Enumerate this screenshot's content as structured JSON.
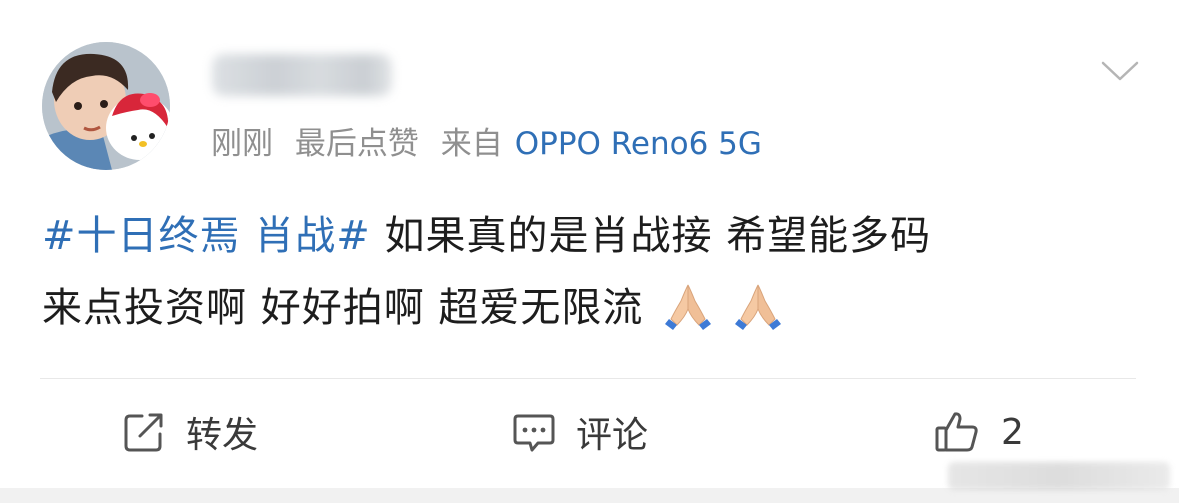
{
  "post": {
    "meta": {
      "time": "刚刚",
      "last_liked": "最后点赞",
      "from_label": "来自",
      "device": "OPPO Reno6 5G"
    },
    "content": {
      "hashtag": "#十日终焉 肖战#",
      "text_line1": " 如果真的是肖战接 希望能多码",
      "text_line2": "来点投资啊 好好拍啊 超爱无限流",
      "emoji": "folded-hands-emoji"
    }
  },
  "actions": {
    "repost_label": "转发",
    "comment_label": "评论",
    "like_count": "2"
  },
  "icons": {
    "menu": "chevron-down-icon",
    "repost": "share-icon",
    "comment": "comment-icon",
    "like": "thumbs-up-icon"
  },
  "colors": {
    "link_blue": "#2f6fb6",
    "meta_gray": "#8f8f8f",
    "text": "#1d1d1d"
  }
}
